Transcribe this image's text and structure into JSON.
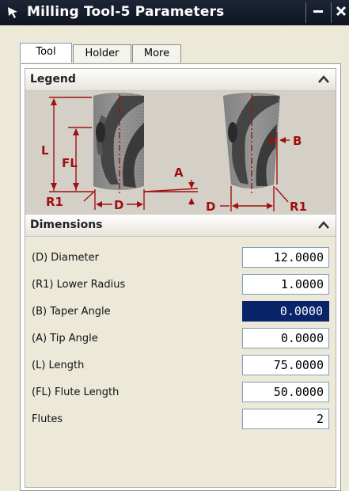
{
  "window": {
    "title": "Milling Tool-5 Parameters"
  },
  "tabs": [
    {
      "label": "Tool",
      "active": true
    },
    {
      "label": "Holder",
      "active": false
    },
    {
      "label": "More",
      "active": false
    }
  ],
  "legend": {
    "header": "Legend",
    "labels": {
      "L": "L",
      "FL": "FL",
      "R1_left": "R1",
      "D_left": "D",
      "A": "A",
      "D_right": "D",
      "B": "B",
      "R1_right": "R1"
    }
  },
  "dimensions": {
    "header": "Dimensions",
    "rows": [
      {
        "label": "(D) Diameter",
        "value": "12.0000",
        "selected": false
      },
      {
        "label": "(R1) Lower Radius",
        "value": "1.0000",
        "selected": false
      },
      {
        "label": "(B) Taper Angle",
        "value": "0.0000",
        "selected": true
      },
      {
        "label": "(A) Tip Angle",
        "value": "0.0000",
        "selected": false
      },
      {
        "label": "(L) Length",
        "value": "75.0000",
        "selected": false
      },
      {
        "label": "(FL) Flute Length",
        "value": "50.0000",
        "selected": false
      },
      {
        "label": "Flutes",
        "value": "2",
        "selected": false
      }
    ]
  },
  "colors": {
    "dimension_red": "#a01010",
    "selection_blue": "#0a246a",
    "titlebar": "#141a29"
  }
}
